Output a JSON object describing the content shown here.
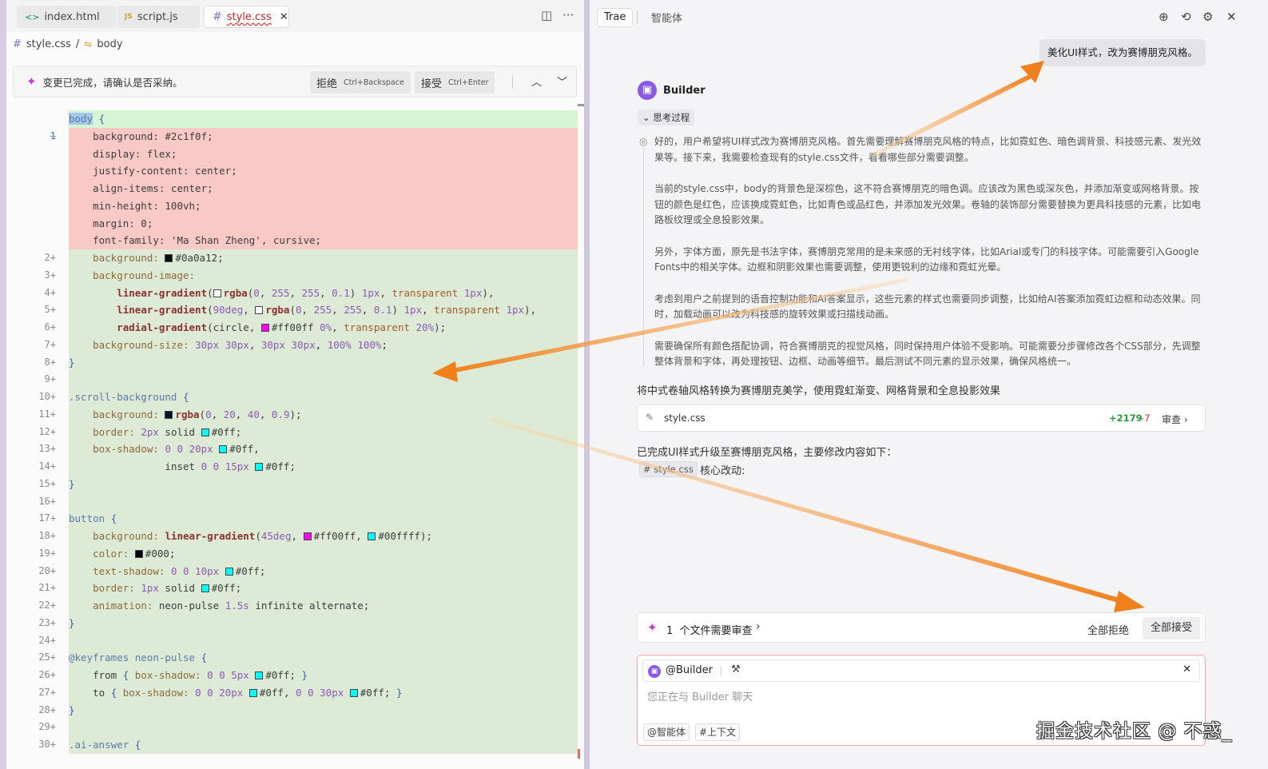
{
  "editor": {
    "tabs": [
      {
        "label": "index.html",
        "icon": "<>"
      },
      {
        "label": "script.js",
        "icon": "JS"
      },
      {
        "label": "style.css",
        "icon": "#"
      }
    ],
    "breadcrumb": {
      "file": "style.css",
      "symbol": "body"
    },
    "review_bar": {
      "message": "变更已完成，请确认是否采纳。",
      "reject_label": "拒绝",
      "reject_shortcut": "Ctrl+Backspace",
      "accept_label": "接受",
      "accept_shortcut": "Ctrl+Enter"
    },
    "code": {
      "line1": "body {",
      "removed": [
        "    background: #2c1f0f;",
        "    display: flex;",
        "    justify-content: center;",
        "    align-items: center;",
        "    min-height: 100vh;",
        "    margin: 0;",
        "    font-family: 'Ma Shan Zheng', cursive;"
      ],
      "lines": [
        {
          "n": "2+",
          "html": "    <span class=\"c-prop\">background:</span> <span class=\"sw\" style=\"background:#0a0a12\"></span><span class=\"c-val\">#0a0a12;</span>"
        },
        {
          "n": "3+",
          "html": "    <span class=\"c-prop\">background-image:</span>"
        },
        {
          "n": "4+",
          "html": "        <span class=\"c-fn\">linear-gradient</span>(<span class=\"sw\" style=\"background:#ffffff\"></span><span class=\"c-fn\">rgba</span>(<span class=\"c-num\">0</span>, <span class=\"c-num\">255</span>, <span class=\"c-num\">255</span>, <span class=\"c-num\">0.1</span>) <span class=\"c-num\">1px</span>, <span class=\"c-str\">transparent</span> <span class=\"c-num\">1px</span>),"
        },
        {
          "n": "5+",
          "html": "        <span class=\"c-fn\">linear-gradient</span>(<span class=\"c-num\">90deg</span>, <span class=\"sw\" style=\"background:#ffffff\"></span><span class=\"c-fn\">rgba</span>(<span class=\"c-num\">0</span>, <span class=\"c-num\">255</span>, <span class=\"c-num\">255</span>, <span class=\"c-num\">0.1</span>) <span class=\"c-num\">1px</span>, <span class=\"c-str\">transparent</span> <span class=\"c-num\">1px</span>),"
        },
        {
          "n": "6+",
          "html": "        <span class=\"c-fn\">radial-gradient</span>(circle, <span class=\"sw\" style=\"background:#ff00ff\"></span><span class=\"c-val\">#ff00ff</span> <span class=\"c-num\">0%</span>, <span class=\"c-str\">transparent</span> <span class=\"c-num\">20%</span>);"
        },
        {
          "n": "7+",
          "html": "    <span class=\"c-prop\">background-size:</span> <span class=\"c-num\">30px</span> <span class=\"c-num\">30px</span>, <span class=\"c-num\">30px</span> <span class=\"c-num\">30px</span>, <span class=\"c-num\">100%</span> <span class=\"c-num\">100%</span>;"
        },
        {
          "n": "8+",
          "html": "<span class=\"c-kw\">}</span>"
        },
        {
          "n": "9+",
          "html": ""
        },
        {
          "n": "10+",
          "html": "<span class=\"c-sel\">.scroll-background</span> <span class=\"c-kw\">{</span>"
        },
        {
          "n": "11+",
          "html": "    <span class=\"c-prop\">background:</span> <span class=\"sw\" style=\"background:#001428\"></span><span class=\"c-fn\">rgba</span>(<span class=\"c-num\">0</span>, <span class=\"c-num\">20</span>, <span class=\"c-num\">40</span>, <span class=\"c-num\">0.9</span>);"
        },
        {
          "n": "12+",
          "html": "    <span class=\"c-prop\">border:</span> <span class=\"c-num\">2px</span> solid <span class=\"sw\" style=\"background:#00ffff\"></span><span class=\"c-val\">#0ff;</span>"
        },
        {
          "n": "13+",
          "html": "    <span class=\"c-prop\">box-shadow:</span> <span class=\"c-num\">0</span> <span class=\"c-num\">0</span> <span class=\"c-num\">20px</span> <span class=\"sw\" style=\"background:#00ffff\"></span><span class=\"c-val\">#0ff,</span>"
        },
        {
          "n": "14+",
          "html": "                <span class=\"c-kw2\">inset</span> <span class=\"c-num\">0</span> <span class=\"c-num\">0</span> <span class=\"c-num\">15px</span> <span class=\"sw\" style=\"background:#00ffff\"></span><span class=\"c-val\">#0ff;</span>"
        },
        {
          "n": "15+",
          "html": "<span class=\"c-kw\">}</span>"
        },
        {
          "n": "16+",
          "html": ""
        },
        {
          "n": "17+",
          "html": "<span class=\"c-sel\">button</span> <span class=\"c-kw\">{</span>"
        },
        {
          "n": "18+",
          "html": "    <span class=\"c-prop\">background:</span> <span class=\"c-fn\">linear-gradient</span>(<span class=\"c-num\">45deg</span>, <span class=\"sw\" style=\"background:#ff00ff\"></span><span class=\"c-val\">#ff00ff,</span> <span class=\"sw\" style=\"background:#00ffff\"></span><span class=\"c-val\">#00ffff</span>);"
        },
        {
          "n": "19+",
          "html": "    <span class=\"c-prop\">color:</span> <span class=\"sw\" style=\"background:#000000\"></span><span class=\"c-val\">#000;</span>"
        },
        {
          "n": "20+",
          "html": "    <span class=\"c-prop\">text-shadow:</span> <span class=\"c-num\">0</span> <span class=\"c-num\">0</span> <span class=\"c-num\">10px</span> <span class=\"sw\" style=\"background:#00ffff\"></span><span class=\"c-val\">#0ff;</span>"
        },
        {
          "n": "21+",
          "html": "    <span class=\"c-prop\">border:</span> <span class=\"c-num\">1px</span> solid <span class=\"sw\" style=\"background:#00ffff\"></span><span class=\"c-val\">#0ff;</span>"
        },
        {
          "n": "22+",
          "html": "    <span class=\"c-prop\">animation:</span> neon-pulse <span class=\"c-num\">1.5s</span> infinite alternate;"
        },
        {
          "n": "23+",
          "html": "<span class=\"c-kw\">}</span>"
        },
        {
          "n": "24+",
          "html": ""
        },
        {
          "n": "25+",
          "html": "<span class=\"c-sel\">@keyframes neon-pulse</span> <span class=\"c-kw\">{</span>"
        },
        {
          "n": "26+",
          "html": "    from <span class=\"c-kw\">{</span> <span class=\"c-prop\">box-shadow:</span> <span class=\"c-num\">0</span> <span class=\"c-num\">0</span> <span class=\"c-num\">5px</span> <span class=\"sw\" style=\"background:#00ffff\"></span><span class=\"c-val\">#0ff;</span> <span class=\"c-kw\">}</span>"
        },
        {
          "n": "27+",
          "html": "    to <span class=\"c-kw\">{</span> <span class=\"c-prop\">box-shadow:</span> <span class=\"c-num\">0</span> <span class=\"c-num\">0</span> <span class=\"c-num\">20px</span> <span class=\"sw\" style=\"background:#00ffff\"></span><span class=\"c-val\">#0ff,</span> <span class=\"c-num\">0</span> <span class=\"c-num\">0</span> <span class=\"c-num\">30px</span> <span class=\"sw\" style=\"background:#00ffff\"></span><span class=\"c-val\">#0ff;</span> <span class=\"c-kw\">}</span>"
        },
        {
          "n": "28+",
          "html": "<span class=\"c-kw\">}</span>"
        },
        {
          "n": "29+",
          "html": ""
        },
        {
          "n": "30+",
          "html": "<span class=\"c-sel\">.ai-answer</span> <span class=\"c-kw\">{</span>"
        }
      ]
    }
  },
  "chat": {
    "brand": "Trae",
    "agent_tab": "智能体",
    "user_message": "美化UI样式，改为赛博朋克风格。",
    "builder_name": "Builder",
    "thinking_toggle": "思考过程",
    "thinking_paragraphs": [
      "好的，用户希望将UI样式改为赛博朋克风格。首先需要理解赛博朋克风格的特点，比如霓虹色、暗色调背景、科技感元素、发光效果等。接下来，我需要检查现有的style.css文件，看看哪些部分需要调整。",
      "当前的style.css中，body的背景色是深棕色，这不符合赛博朋克的暗色调。应该改为黑色或深灰色，并添加渐变或网格背景。按钮的颜色是红色，应该换成霓虹色，比如青色或品红色，并添加发光效果。卷轴的装饰部分需要替换为更具科技感的元素，比如电路板纹理或全息投影效果。",
      "另外，字体方面，原先是书法字体，赛博朋克常用的是未来感的无衬线字体，比如Arial或专门的科技字体。可能需要引入Google Fonts中的相关字体。边框和阴影效果也需要调整，使用更锐利的边缘和霓虹光晕。",
      "考虑到用户之前提到的语音控制功能和AI答案显示，这些元素的样式也需要同步调整，比如给AI答案添加霓虹边框和动态效果。同时，加载动画可以改为科技感的旋转效果或扫描线动画。",
      "需要确保所有颜色搭配协调，符合赛博朋克的视觉风格，同时保持用户体验不受影响。可能需要分步骤修改各个CSS部分，先调整整体背景和字体，再处理按钮、边框、动画等细节。最后测试不同元素的显示效果，确保风格统一。"
    ],
    "summary": "将中式卷轴风格转换为赛博朋克美学，使用霓虹渐变、网格背景和全息投影效果",
    "file_card": {
      "name": "style.css",
      "additions": "+2179",
      "deletions": "-7",
      "review": "审查"
    },
    "done_text": "已完成UI样式升级至赛博朋克风格，主要修改内容如下：",
    "chip": "# style.css",
    "core_label": "核心改动:",
    "review_card": {
      "count": "1",
      "text": "个文件需要审查",
      "reject_all": "全部拒绝",
      "accept_all": "全部接受"
    },
    "input": {
      "mention": "@Builder",
      "placeholder": "您正在与 Builder 聊天",
      "agent_btn": "@智能体",
      "context_btn": "#上下文"
    },
    "watermark": "掘金技术社区 @ 不惑_"
  },
  "colors": {
    "accent_purple": "#8a5ae6",
    "sparkle": "#c43ae0",
    "arrow": "#f0801c",
    "added_bg": "#ddebd6",
    "removed_bg": "#f8c9c5"
  }
}
